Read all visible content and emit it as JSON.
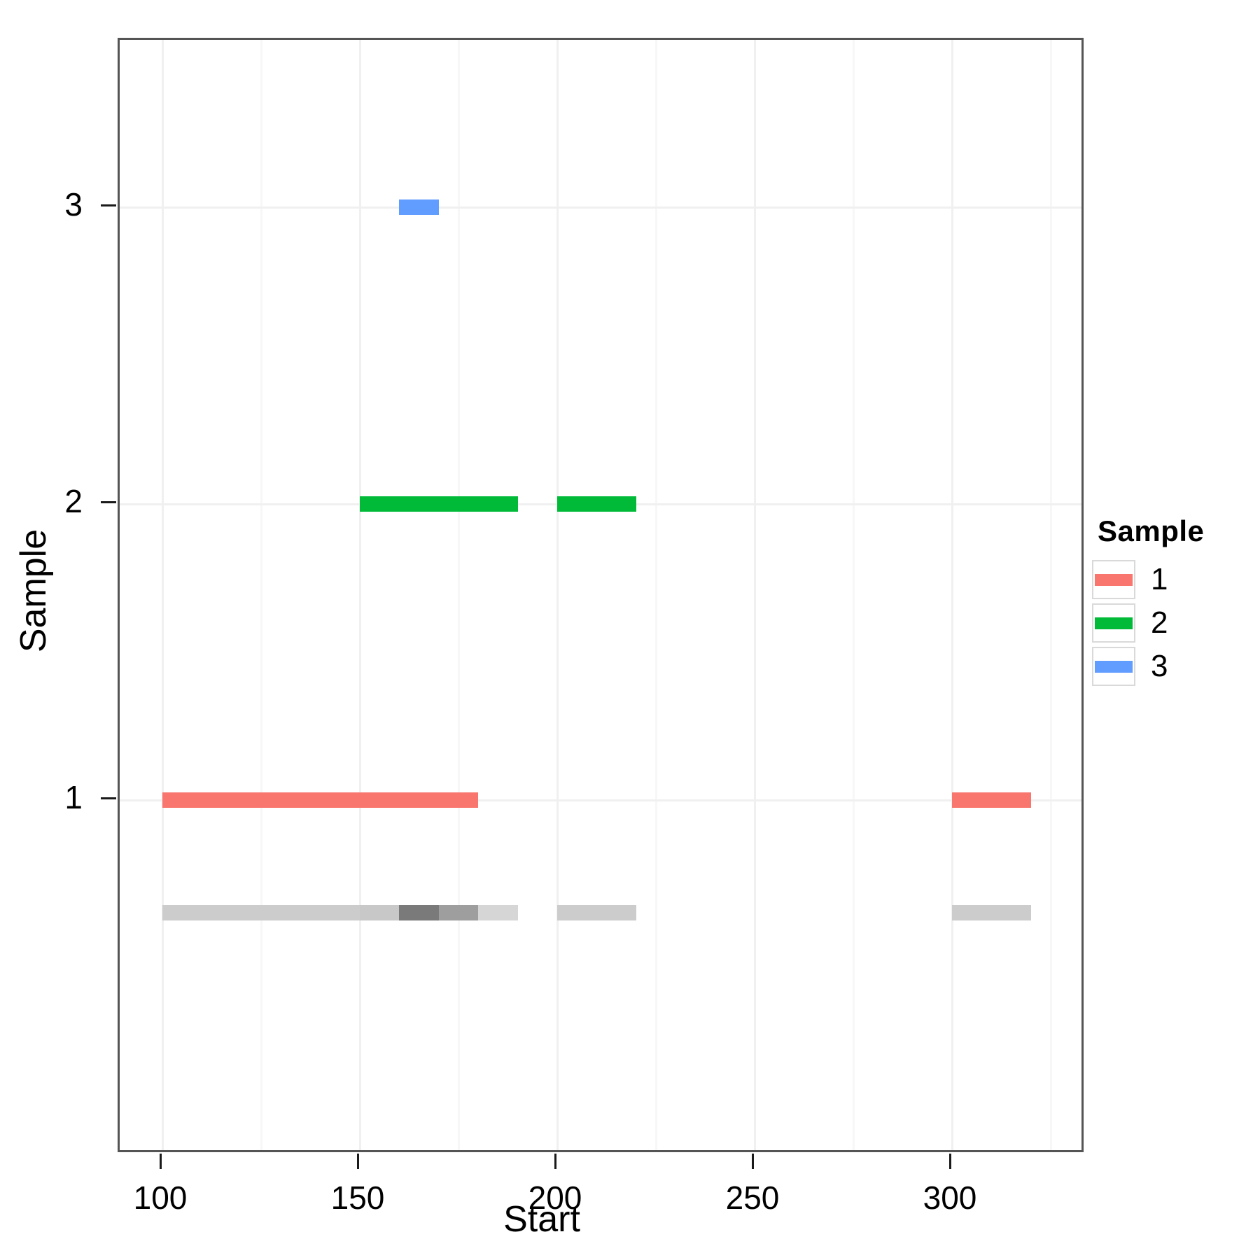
{
  "chart_data": {
    "type": "bar",
    "title": "",
    "xlabel": "Start",
    "ylabel": "Sample",
    "xlim": [
      90,
      330
    ],
    "ylim": [
      0.45,
      3.55
    ],
    "grid": true,
    "legend_position": "right",
    "legend_title": "Sample",
    "x_ticks": [
      100,
      150,
      200,
      250,
      300
    ],
    "y_ticks": [
      1,
      2,
      3
    ],
    "colors": {
      "sample_1": "#F8766D",
      "sample_2": "#00BA38",
      "sample_3": "#619CFF",
      "grid": "#F0F0F0",
      "panel_border": "#555555",
      "coverage_light": "#CCCCCC",
      "coverage_mid": "#A5A5A5",
      "coverage_dark": "#7A7A7A",
      "coverage_lighter": "#D6D6D6"
    },
    "series": [
      {
        "name": "1",
        "sample": 1,
        "color": "#F8766D",
        "intervals": [
          {
            "start": 100,
            "end": 180
          },
          {
            "start": 300,
            "end": 320
          }
        ]
      },
      {
        "name": "2",
        "sample": 2,
        "color": "#00BA38",
        "intervals": [
          {
            "start": 150,
            "end": 190
          },
          {
            "start": 200,
            "end": 220
          }
        ]
      },
      {
        "name": "3",
        "sample": 3,
        "color": "#619CFF",
        "intervals": [
          {
            "start": 160,
            "end": 170
          }
        ]
      }
    ],
    "coverage_track": {
      "y_value": 0.62,
      "segments": [
        {
          "start": 100,
          "end": 150,
          "depth": 1,
          "color": "#CCCCCC"
        },
        {
          "start": 150,
          "end": 160,
          "depth": 2,
          "color": "#C8C8C8"
        },
        {
          "start": 160,
          "end": 170,
          "depth": 3,
          "color": "#7A7A7A"
        },
        {
          "start": 170,
          "end": 175,
          "depth": 2,
          "color": "#9E9E9E"
        },
        {
          "start": 175,
          "end": 180,
          "depth": 2,
          "color": "#9E9E9E"
        },
        {
          "start": 180,
          "end": 190,
          "depth": 1,
          "color": "#D6D6D6"
        },
        {
          "start": 200,
          "end": 220,
          "depth": 1,
          "color": "#CCCCCC"
        },
        {
          "start": 300,
          "end": 320,
          "depth": 1,
          "color": "#CCCCCC"
        }
      ]
    }
  },
  "axes": {
    "x_tick_labels": [
      "100",
      "150",
      "200",
      "250",
      "300"
    ],
    "y_tick_labels": [
      "3",
      "2",
      "1"
    ],
    "x_axis_title": "Start",
    "y_axis_title": "Sample"
  },
  "legend": {
    "title": "Sample",
    "entries": [
      {
        "label": "1",
        "color": "#F8766D"
      },
      {
        "label": "2",
        "color": "#00BA38"
      },
      {
        "label": "3",
        "color": "#619CFF"
      }
    ]
  }
}
